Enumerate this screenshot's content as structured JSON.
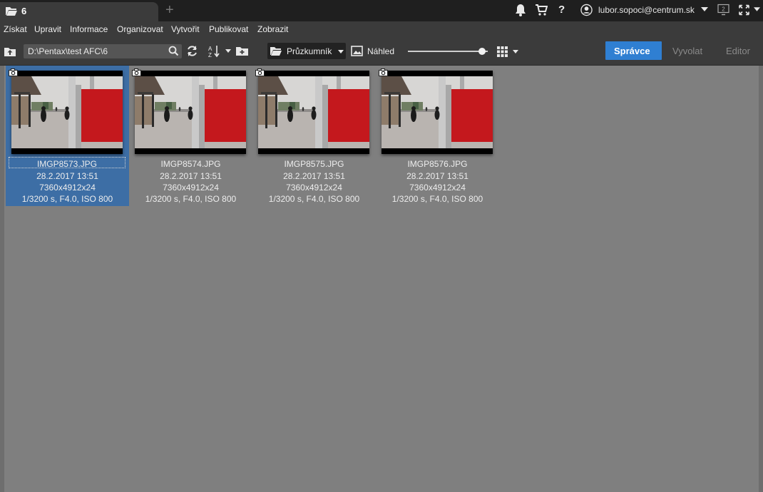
{
  "tab": {
    "title": "6",
    "new_tab": "+"
  },
  "user": {
    "name": "lubor.sopoci@centrum.sk"
  },
  "header_icons": [
    "bell-icon",
    "cart-icon",
    "help-icon",
    "user-icon",
    "monitor-icon",
    "fullscreen-icon"
  ],
  "help_glyph": "?",
  "monitor_badge": "2",
  "menu": [
    "Získat",
    "Upravit",
    "Informace",
    "Organizovat",
    "Vytvořit",
    "Publikovat",
    "Zobrazit"
  ],
  "toolbar": {
    "path": "D:\\Pentax\\test AFC\\6",
    "browser_mode": "Průzkumník",
    "preview_label": "Náhled",
    "thumbnail_size_fraction": 0.93
  },
  "modes": {
    "active": "Správce",
    "develop": "Vyvolat",
    "editor": "Editor"
  },
  "accent_color": "#2f7fd2",
  "files": [
    {
      "name": "IMGP8573.JPG",
      "date": "28.2.2017 13:51",
      "dimensions": "7360x4912x24",
      "exif": "1/3200 s, F4.0, ISO 800",
      "selected": true
    },
    {
      "name": "IMGP8574.JPG",
      "date": "28.2.2017 13:51",
      "dimensions": "7360x4912x24",
      "exif": "1/3200 s, F4.0, ISO 800",
      "selected": false
    },
    {
      "name": "IMGP8575.JPG",
      "date": "28.2.2017 13:51",
      "dimensions": "7360x4912x24",
      "exif": "1/3200 s, F4.0, ISO 800",
      "selected": false
    },
    {
      "name": "IMGP8576.JPG",
      "date": "28.2.2017 13:51",
      "dimensions": "7360x4912x24",
      "exif": "1/3200 s, F4.0, ISO 800",
      "selected": false
    }
  ]
}
